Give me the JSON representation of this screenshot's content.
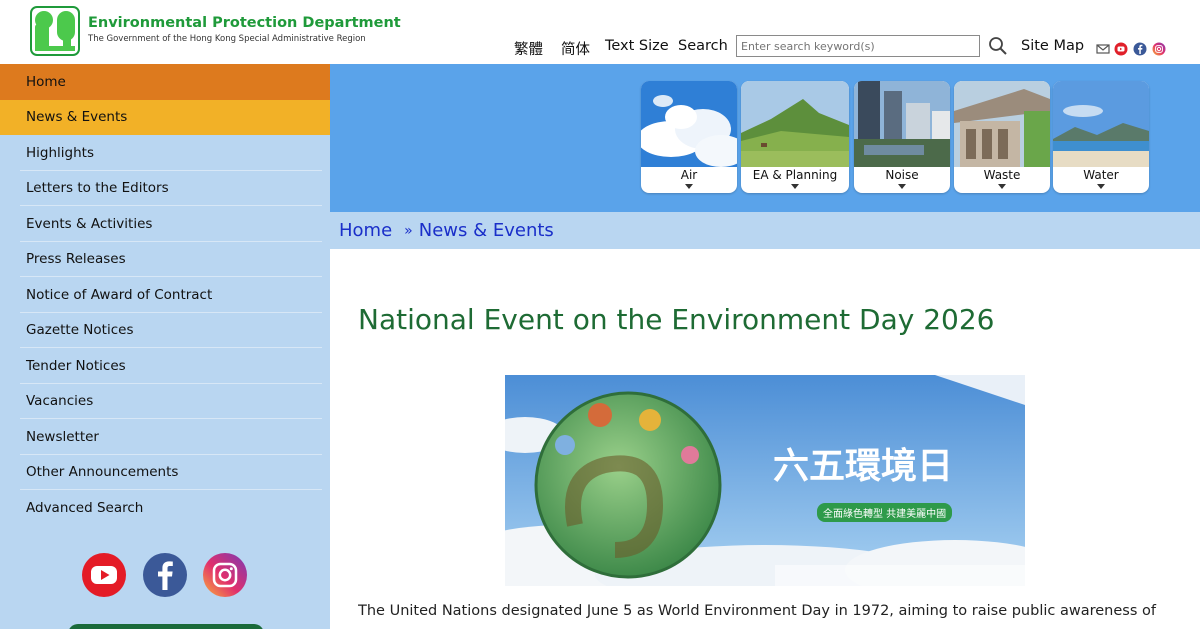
{
  "header": {
    "dept_name": "Environmental Protection Department",
    "gov_name": "The Government of the Hong Kong Special Administrative Region",
    "trad_chinese": "繁體",
    "simp_chinese": "简体",
    "text_size": "Text Size",
    "search_label": "Search",
    "search_placeholder": "Enter search keyword(s)",
    "site_map": "Site Map",
    "icons": [
      "mail-icon",
      "youtube-icon",
      "facebook-icon",
      "instagram-icon"
    ]
  },
  "sidebar": {
    "items": [
      {
        "label": "Home"
      },
      {
        "label": "News & Events"
      },
      {
        "label": "Highlights"
      },
      {
        "label": "Letters to the Editors"
      },
      {
        "label": "Events & Activities"
      },
      {
        "label": "Press Releases"
      },
      {
        "label": "Notice of Award of Contract"
      },
      {
        "label": "Gazette Notices"
      },
      {
        "label": "Tender Notices"
      },
      {
        "label": "Vacancies"
      },
      {
        "label": "Newsletter"
      },
      {
        "label": "Other Announcements"
      },
      {
        "label": "Advanced Search"
      }
    ],
    "social": [
      "youtube-icon",
      "facebook-icon",
      "instagram-icon"
    ]
  },
  "banner": {
    "tiles": [
      {
        "label": "Air"
      },
      {
        "label": "EA & Planning"
      },
      {
        "label": "Noise"
      },
      {
        "label": "Waste"
      },
      {
        "label": "Water"
      }
    ]
  },
  "breadcrumb": {
    "home": "Home",
    "separator": "»",
    "current": "News & Events"
  },
  "main": {
    "title": "National Event on the Environment Day 2026",
    "poster_heading": "六五環境日",
    "poster_sub": "全面綠色轉型  共建美麗中國",
    "body_first_line": "The United Nations designated June 5 as World Environment Day in 1972, aiming to raise public awareness of"
  },
  "colors": {
    "brand_green": "#1f9a3a",
    "title_green": "#1e6b34",
    "sidebar_blue": "#b9d6f1",
    "banner_blue": "#5aa3ea",
    "home_orange": "#dd7a1e",
    "news_orange": "#f2b127",
    "link_blue": "#1a2fc9"
  }
}
